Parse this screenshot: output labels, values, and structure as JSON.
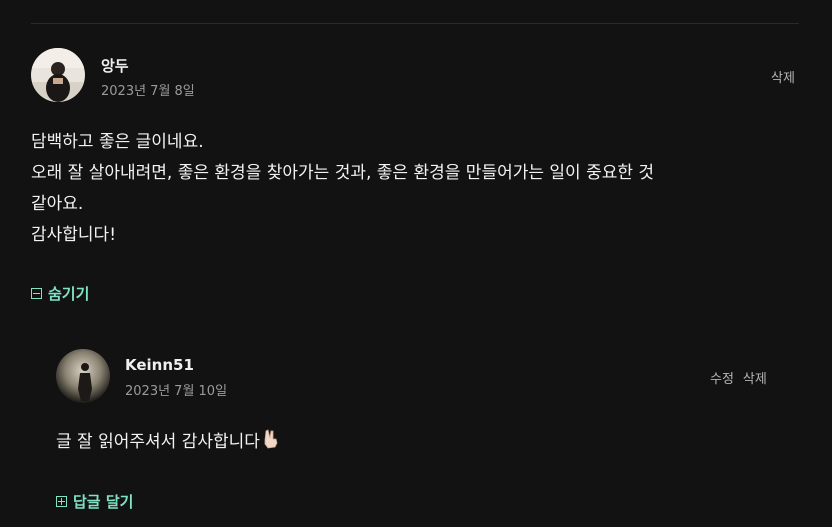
{
  "comment": {
    "author": "앙두",
    "date": "2023년 7월 8일",
    "delete_label": "삭제",
    "body_lines": [
      "담백하고 좋은 글이네요.",
      "오래 잘 살아내려면, 좋은 환경을 찾아가는 것과, 좋은 환경을 만들어가는 일이 중요한 것",
      "같아요.",
      "감사합니다!"
    ],
    "toggle_label": "숨기기"
  },
  "reply": {
    "author": "Keinn51",
    "date": "2023년 7월 10일",
    "edit_label": "수정",
    "delete_label": "삭제",
    "body": "글 잘 읽어주셔서 감사합니다",
    "emoji_icon": "victory-hand-icon",
    "reply_label": "답글 달기"
  },
  "colors": {
    "background": "#121212",
    "accent": "#7fe3c4",
    "muted": "#9a9a9a"
  }
}
